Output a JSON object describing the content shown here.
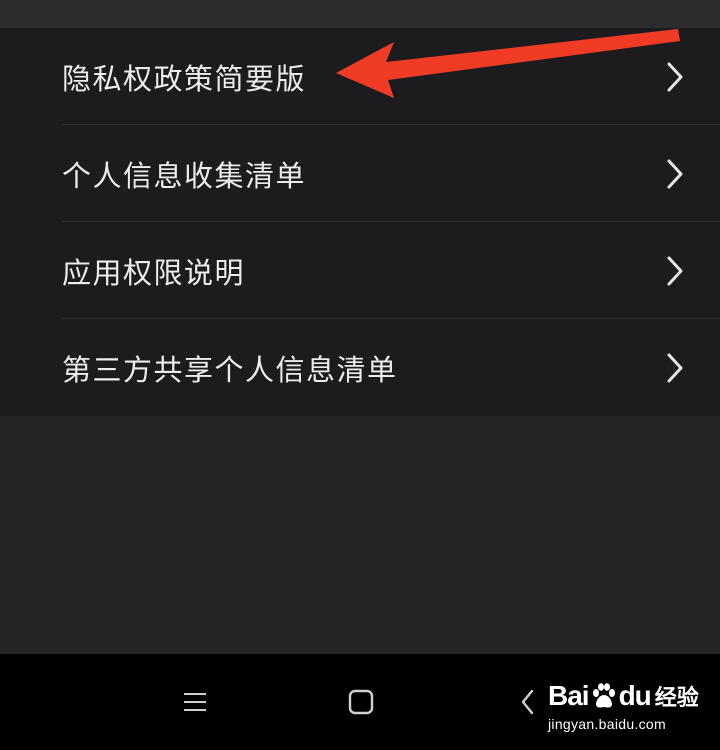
{
  "menu": {
    "items": [
      {
        "label": "隐私权政策简要版",
        "icon": "chevron-right-icon"
      },
      {
        "label": "个人信息收集清单",
        "icon": "chevron-right-icon"
      },
      {
        "label": "应用权限说明",
        "icon": "chevron-right-icon"
      },
      {
        "label": "第三方共享个人信息清单",
        "icon": "chevron-right-icon"
      }
    ]
  },
  "annotation": {
    "type": "arrow",
    "color": "#f03c25",
    "points_to": "隐私权政策简要版"
  },
  "navigation_bar": {
    "buttons": [
      {
        "name": "menu-icon"
      },
      {
        "name": "home-icon"
      },
      {
        "name": "back-icon"
      }
    ]
  },
  "watermark": {
    "brand_left": "Bai",
    "brand_right": "du",
    "brand_suffix": "经验",
    "url": "jingyan.baidu.com"
  },
  "colors": {
    "background": "#252527",
    "list_background": "#1c1c1e",
    "text": "#ececec",
    "divider": "#303033",
    "nav_bar": "#000000",
    "arrow": "#f03c25"
  }
}
